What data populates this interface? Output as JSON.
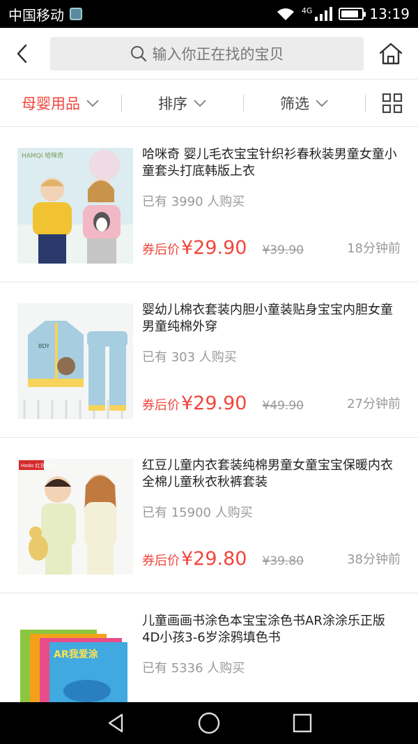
{
  "status_bar": {
    "carrier": "中国移动",
    "network": "4G",
    "time": "13:19",
    "battery_level": 0.85
  },
  "header": {
    "search_placeholder": "输入你正在找的宝贝"
  },
  "filters": {
    "category": "母婴用品",
    "sort": "排序",
    "filter": "筛选"
  },
  "products": [
    {
      "title": "哈咪奇 婴儿毛衣宝宝针织衫春秋装男童女童小童套头打底韩版上衣",
      "sales": "已有 3990 人购买",
      "price_label": "券后价",
      "price": "¥29.90",
      "original_price": "¥39.90",
      "time_ago": "18分钟前",
      "thumb_brand": "HAMQI 哈咪奇"
    },
    {
      "title": "婴幼儿棉衣套装内胆小童装贴身宝宝内胆女童男童纯棉外穿",
      "sales": "已有 303 人购买",
      "price_label": "券后价",
      "price": "¥29.90",
      "original_price": "¥49.90",
      "time_ago": "27分钟前",
      "thumb_brand": "BDY"
    },
    {
      "title": "红豆儿童内衣套装纯棉男童女童宝宝保暖内衣全棉儿童秋衣秋裤套装",
      "sales": "已有 15900 人购买",
      "price_label": "券后价",
      "price": "¥29.80",
      "original_price": "¥39.80",
      "time_ago": "38分钟前",
      "thumb_brand": "Hodo 红豆居家"
    },
    {
      "title": "儿童画画书涂色本宝宝涂色书AR涂涂乐正版4D小孩3-6岁涂鸦填色书",
      "sales": "已有 5336 人购买",
      "thumb_brand": "AR我爱涂"
    }
  ],
  "colors": {
    "accent": "#f0463c",
    "muted": "#999999",
    "search_bg": "#ececec"
  }
}
